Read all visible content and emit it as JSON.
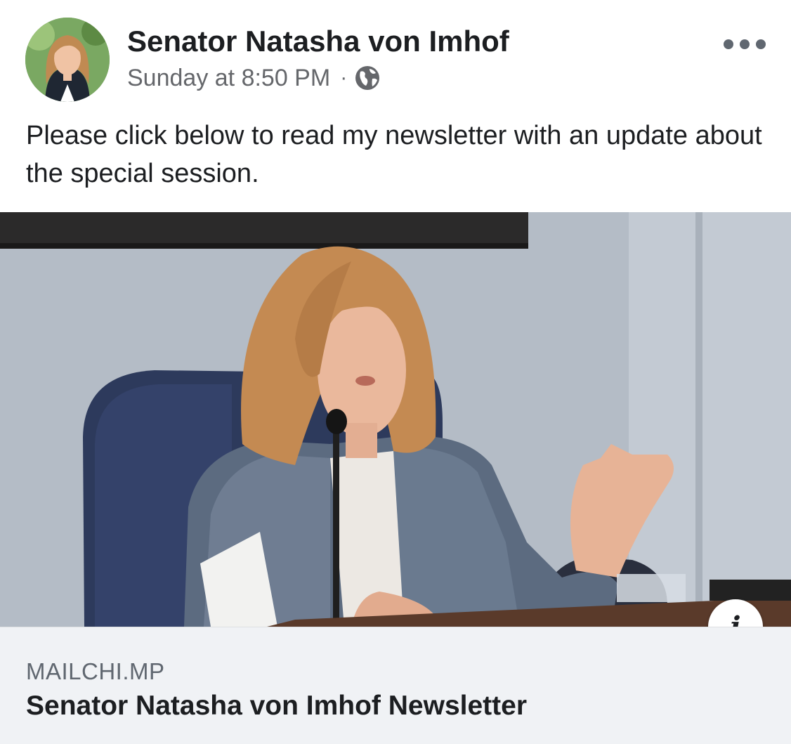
{
  "post": {
    "author": {
      "name": "Senator Natasha von Imhof",
      "avatar_icon": "profile-photo"
    },
    "timestamp": "Sunday at 8:50 PM",
    "separator": "·",
    "audience_icon": "globe-icon",
    "more_icon": "more-options-icon",
    "text": "Please click below to read my newsletter with an update about the special session."
  },
  "link_preview": {
    "image_icon": "link-preview-photo",
    "info_label": "i",
    "domain": "MAILCHI.MP",
    "title": "Senator Natasha von Imhof Newsletter"
  },
  "colors": {
    "name_text": "#1c1e21",
    "meta_text": "#65676b",
    "footer_bg": "#f0f2f5"
  }
}
